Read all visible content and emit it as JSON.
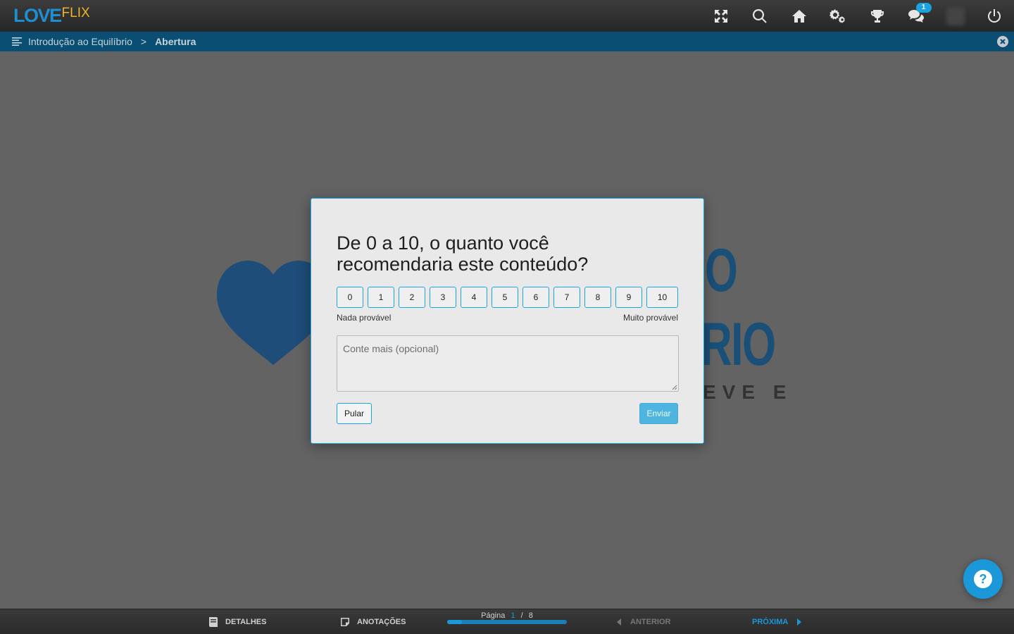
{
  "app": {
    "logo_love": "LOVE",
    "logo_flix": "FLIX"
  },
  "topbar": {
    "icons": [
      "fullscreen-icon",
      "search-icon",
      "home-icon",
      "settings-icon",
      "trophy-icon",
      "chat-icon",
      "avatar",
      "power-icon"
    ],
    "chat_badge": "1"
  },
  "breadcrumb": {
    "items": [
      "Introdução ao Equilíbrio",
      "Abertura"
    ],
    "separator": ">"
  },
  "background": {
    "big_line_1": "O",
    "big_line_2": "RIO",
    "small_line": "EVE E"
  },
  "survey": {
    "question": "De 0 a 10, o quanto você recomendaria este conteúdo?",
    "scale": [
      "0",
      "1",
      "2",
      "3",
      "4",
      "5",
      "6",
      "7",
      "8",
      "9",
      "10"
    ],
    "low_label": "Nada provável",
    "high_label": "Muito provável",
    "comment_placeholder": "Conte mais (opcional)",
    "skip_label": "Pular",
    "submit_label": "Enviar"
  },
  "help": {
    "label": "?"
  },
  "bottombar": {
    "details_label": "DETALHES",
    "notes_label": "ANOTAÇÕES",
    "page_label": "Página",
    "page_current": "1",
    "page_separator": "/",
    "page_total": "8",
    "progress_fraction": 0.125,
    "prev_label": "ANTERIOR",
    "next_label": "PRÓXIMA"
  },
  "colors": {
    "accent": "#1a98d9",
    "breadcrumb_bg": "#0a4f73",
    "logo_love": "#1d8fd1",
    "logo_flix": "#f0b323"
  }
}
